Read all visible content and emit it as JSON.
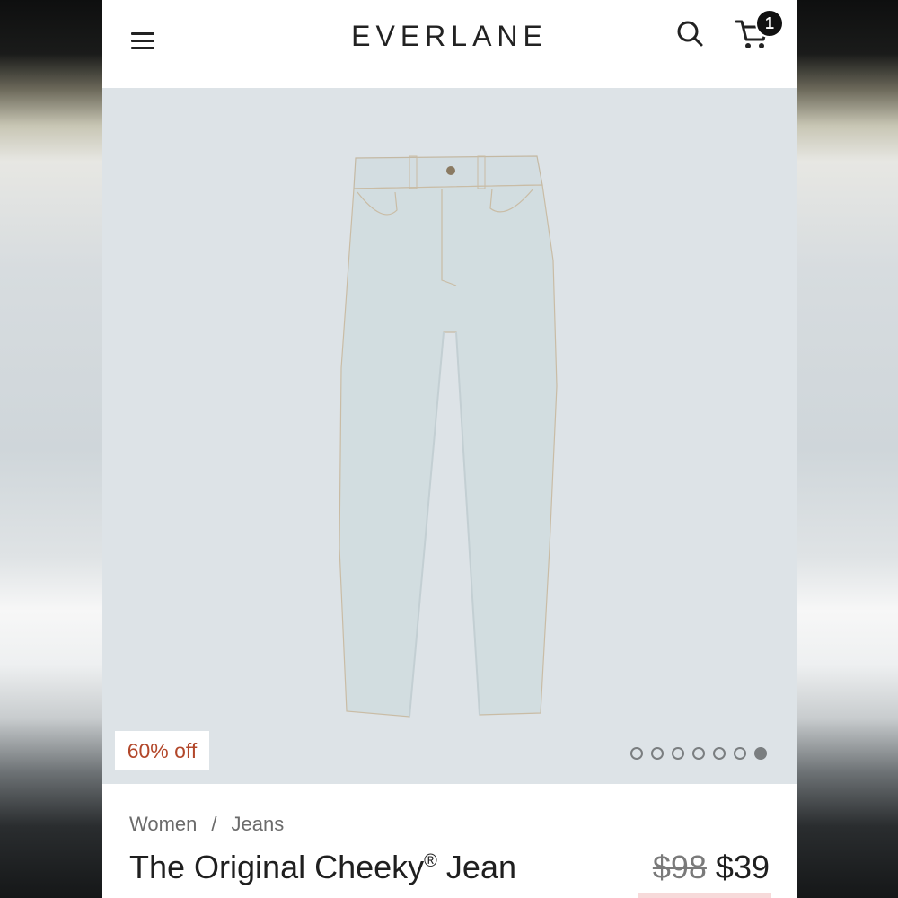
{
  "header": {
    "brand": "EVERLANE",
    "cart_count": "1"
  },
  "icons": {
    "menu": "hamburger-menu-icon",
    "search": "search-icon",
    "cart": "cart-icon"
  },
  "hero": {
    "discount_label": "60% off",
    "carousel_dots": 7,
    "active_dot": 7
  },
  "product": {
    "breadcrumb": [
      "Women",
      "Jeans"
    ],
    "breadcrumb_separator": "/",
    "title": "The Original Cheeky",
    "title_mark": "®",
    "title_suffix": "Jean",
    "original_price": "$98",
    "sale_price": "$39"
  },
  "colors": {
    "hero_background": "#dde3e7",
    "discount_text": "#b2472a",
    "jeans": "#d2dde0"
  }
}
